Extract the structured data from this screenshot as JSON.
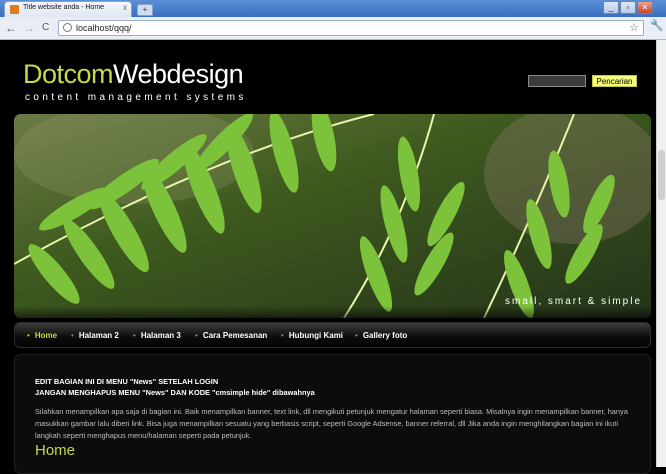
{
  "browser": {
    "tab_title": "Title website anda - Home",
    "tab_close": "x",
    "new_tab": "+",
    "window_buttons": [
      "_",
      "▫",
      "✕"
    ],
    "nav": {
      "back": "←",
      "forward": "→",
      "reload": "C"
    },
    "url": "localhost/qqq/"
  },
  "header": {
    "logo_part1": "Dotcom",
    "logo_part2": "Webdesign",
    "tagline": "content management systems",
    "search_button": "Pencarian"
  },
  "banner": {
    "motto": "small, smart & simple"
  },
  "menu": [
    {
      "label": "Home",
      "active": true
    },
    {
      "label": "Halaman 2",
      "active": false
    },
    {
      "label": "Halaman 3",
      "active": false
    },
    {
      "label": "Cara Pemesanan",
      "active": false
    },
    {
      "label": "Hubungi Kami",
      "active": false
    },
    {
      "label": "Gallery foto",
      "active": false
    }
  ],
  "content": {
    "notice_line1": "EDIT BAGIAN INI DI MENU \"News\" SETELAH LOGIN",
    "notice_line2": "JANGAN MENGHAPUS MENU \"News\" DAN KODE \"cmsimple hide\" dibawahnya",
    "paragraph": "Silahkan menampilkan apa saja di bagian ini. Baik menampilkan banner, text link, dll mengikuti petunjuk mengatur halaman seperti biasa. Misalnya ingin menampilkan banner, hanya masukkan gambar lalu diberi link. Bisa juga menampilkan sesuatu yang berbasis script, seperti Google Adsense, banner referral, dll Jika anda ingin menghilangkan bagian ini ikuti langkah seperti menghapus menu/halaman seperti pada petunjuk.",
    "heading": "Home"
  },
  "colors": {
    "accent": "#c7d84a",
    "background": "#000000",
    "search_button": "#f6ff7a"
  }
}
